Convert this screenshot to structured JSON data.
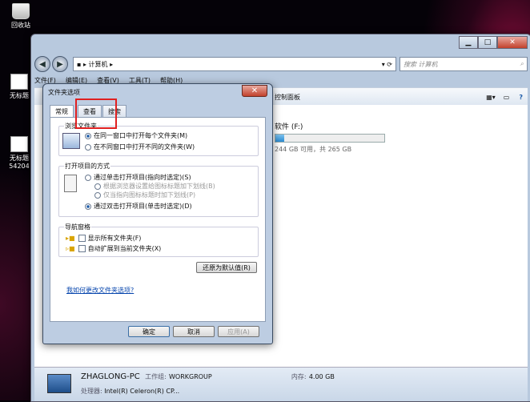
{
  "desktop": {
    "icons": [
      {
        "label": "回收站"
      },
      {
        "label": "无标题"
      },
      {
        "label": "无标题",
        "label2": "54204"
      }
    ]
  },
  "explorer": {
    "address": "计算机",
    "search_placeholder": "搜索 计算机",
    "menu": [
      "文件(F)",
      "编辑(E)",
      "查看(V)",
      "工具(T)",
      "帮助(H)"
    ],
    "toolbar_item": "控制面板",
    "drive": {
      "label": "软件 (F:)",
      "capacity": "244 GB 可用，共 265 GB",
      "used_fraction": 0.08
    },
    "details": {
      "name": "ZHAGLONG-PC",
      "workgroup_label": "工作组:",
      "workgroup": "WORKGROUP",
      "memory_label": "内存:",
      "memory": "4.00 GB",
      "cpu_label": "处理器:",
      "cpu": "Intel(R) Celeron(R) CP..."
    }
  },
  "dialog": {
    "title": "文件夹选项",
    "close": "✕",
    "tabs": [
      "常规",
      "查看",
      "搜索"
    ],
    "browse_group": "浏览文件夹",
    "browse_opt1": "在同一窗口中打开每个文件夹(M)",
    "browse_opt2": "在不同窗口中打开不同的文件夹(W)",
    "click_group": "打开项目的方式",
    "click_opt1": "通过单击打开项目(指向时选定)(S)",
    "click_sub1": "根据浏览器设置给图标标题加下划线(B)",
    "click_sub2": "仅当指向图标标题时加下划线(P)",
    "click_opt2": "通过双击打开项目(单击时选定)(D)",
    "nav_group": "导航窗格",
    "nav_chk1": "显示所有文件夹(F)",
    "nav_chk2": "自动扩展到当前文件夹(X)",
    "restore": "还原为默认值(R)",
    "help_link": "我如何更改文件夹选项?",
    "ok": "确定",
    "cancel": "取消",
    "apply": "应用(A)"
  }
}
